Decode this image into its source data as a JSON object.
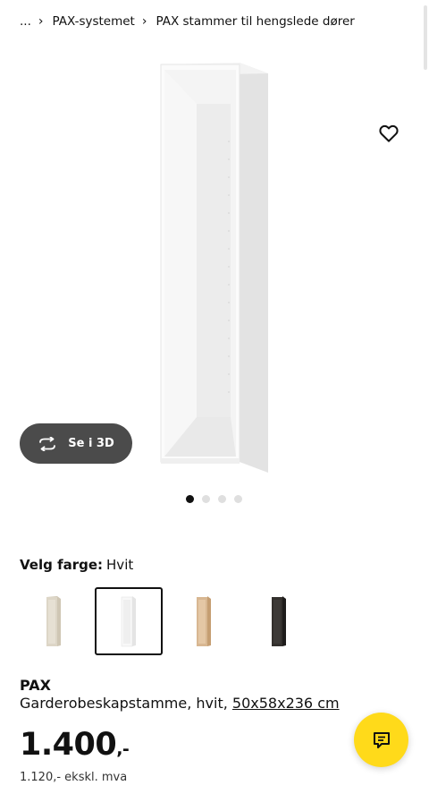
{
  "breadcrumb": {
    "ellipsis": "...",
    "items": [
      "PAX-systemet",
      "PAX stammer til hengslede dører"
    ]
  },
  "gallery": {
    "view3d_label": "Se i 3D",
    "dot_count": 4,
    "active_dot": 1
  },
  "color_picker": {
    "label": "Velg farge:",
    "selected_value": "Hvit",
    "options": [
      {
        "name": "beige",
        "color": "#d7d0c0"
      },
      {
        "name": "hvit",
        "color": "#f5f5f5"
      },
      {
        "name": "eikemønstret",
        "color": "#d4b48e"
      },
      {
        "name": "svartbrun",
        "color": "#2d2b29"
      }
    ],
    "selected_index": 1
  },
  "product": {
    "name": "PAX",
    "description": "Garderobeskapstamme, hvit,",
    "dimensions": "50x58x236 cm",
    "price": "1.400",
    "price_suffix": ",-",
    "price_ex_vat": "1.120,- ekskl. mva"
  },
  "icons": {
    "favorite": "heart-icon",
    "view3d": "rotate-3d-icon",
    "chat": "chat-icon",
    "breadcrumb_separator": "chevron-right-icon"
  },
  "colors": {
    "accent_yellow": "#ffda1a",
    "button_dark": "#4b4b4b"
  }
}
